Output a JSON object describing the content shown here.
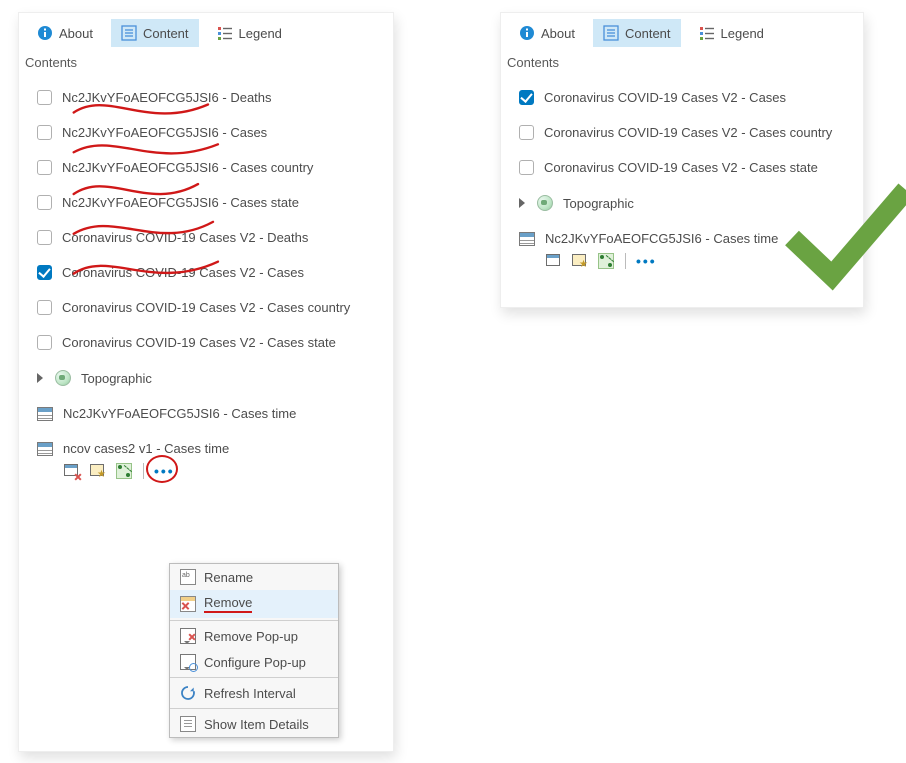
{
  "tabs": {
    "about": "About",
    "content": "Content",
    "legend": "Legend"
  },
  "section_title": "Contents",
  "left": {
    "layers": [
      {
        "label": "Nc2JKvYFoAEOFCG5JSI6 - Deaths",
        "checked": false,
        "scribble": true
      },
      {
        "label": "Nc2JKvYFoAEOFCG5JSI6 - Cases",
        "checked": false,
        "scribble": true
      },
      {
        "label": "Nc2JKvYFoAEOFCG5JSI6 - Cases country",
        "checked": false,
        "scribble": true
      },
      {
        "label": "Nc2JKvYFoAEOFCG5JSI6 - Cases state",
        "checked": false,
        "scribble": true
      },
      {
        "label": "Coronavirus COVID-19 Cases V2 - Deaths",
        "checked": false,
        "scribble": true
      },
      {
        "label": "Coronavirus COVID-19 Cases V2 - Cases",
        "checked": true,
        "scribble": false
      },
      {
        "label": "Coronavirus COVID-19 Cases V2 - Cases country",
        "checked": false,
        "scribble": false
      },
      {
        "label": "Coronavirus COVID-19 Cases V2 - Cases state",
        "checked": false,
        "scribble": false
      }
    ],
    "basemap": "Topographic",
    "table_layers": [
      "Nc2JKvYFoAEOFCG5JSI6 - Cases time",
      "ncov cases2 v1 - Cases time"
    ]
  },
  "right": {
    "layers": [
      {
        "label": "Coronavirus COVID-19 Cases V2 - Cases",
        "checked": true
      },
      {
        "label": "Coronavirus COVID-19 Cases V2 - Cases country",
        "checked": false
      },
      {
        "label": "Coronavirus COVID-19 Cases V2 - Cases state",
        "checked": false
      }
    ],
    "basemap": "Topographic",
    "table_layer": "Nc2JKvYFoAEOFCG5JSI6 - Cases time"
  },
  "context_menu": {
    "rename": "Rename",
    "remove": "Remove",
    "remove_popup": "Remove Pop-up",
    "configure_popup": "Configure Pop-up",
    "refresh": "Refresh Interval",
    "details": "Show Item Details"
  },
  "annotation": {
    "color": "#d01818",
    "check_color": "#6aa342"
  }
}
